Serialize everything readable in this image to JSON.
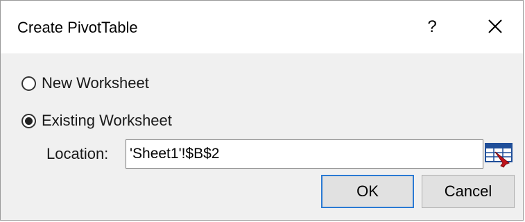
{
  "window": {
    "title": "Create PivotTable",
    "help_label": "?",
    "close_icon": "close-icon"
  },
  "destination": {
    "options": [
      {
        "label": "New Worksheet",
        "checked": false
      },
      {
        "label": "Existing Worksheet",
        "checked": true
      }
    ]
  },
  "location": {
    "label": "Location:",
    "value": "'Sheet1'!$B$2",
    "collapse_icon": "range-select-icon"
  },
  "buttons": {
    "ok_label": "OK",
    "cancel_label": "Cancel"
  },
  "colors": {
    "accent": "#2a7ad4",
    "dialog_bg": "#f0f0f0",
    "icon_blue": "#1f4e99",
    "icon_red": "#c0141c"
  }
}
